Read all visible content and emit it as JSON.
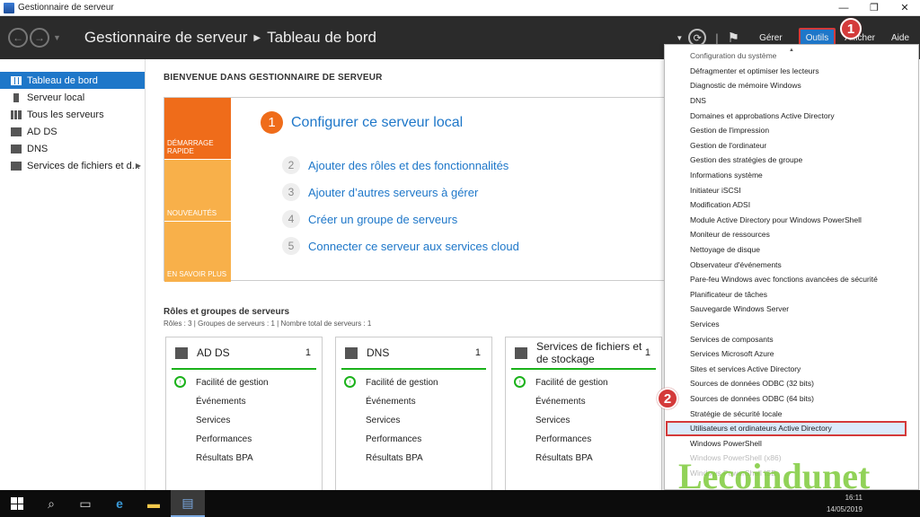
{
  "window": {
    "title": "Gestionnaire de serveur",
    "minimize": "—",
    "restore": "❐",
    "close": "✕"
  },
  "header": {
    "breadcrumb_app": "Gestionnaire de serveur",
    "breadcrumb_page": "Tableau de bord",
    "menus": {
      "gerer": "Gérer",
      "outils": "Outils",
      "afficher": "Afficher",
      "aide": "Aide"
    }
  },
  "sidebar": {
    "items": [
      {
        "label": "Tableau de bord"
      },
      {
        "label": "Serveur local"
      },
      {
        "label": "Tous les serveurs"
      },
      {
        "label": "AD DS"
      },
      {
        "label": "DNS"
      },
      {
        "label": "Services de fichiers et d..."
      }
    ]
  },
  "welcome": {
    "title": "BIENVENUE DANS GESTIONNAIRE DE SERVEUR",
    "tiles": [
      "DÉMARRAGE RAPIDE",
      "NOUVEAUTÉS",
      "EN SAVOIR PLUS"
    ],
    "steps": [
      {
        "num": "1",
        "label": "Configurer ce serveur local"
      },
      {
        "num": "2",
        "label": "Ajouter des rôles et des fonctionnalités"
      },
      {
        "num": "3",
        "label": "Ajouter d’autres serveurs à gérer"
      },
      {
        "num": "4",
        "label": "Créer un groupe de serveurs"
      },
      {
        "num": "5",
        "label": "Connecter ce serveur aux services cloud"
      }
    ]
  },
  "roles": {
    "title": "Rôles et groupes de serveurs",
    "summary": "Rôles : 3   |   Groupes de serveurs : 1   |   Nombre total de serveurs : 1",
    "cards": [
      {
        "name": "AD DS",
        "count": "1",
        "rows": [
          "Facilité de gestion",
          "Événements",
          "Services",
          "Performances",
          "Résultats BPA"
        ]
      },
      {
        "name": "DNS",
        "count": "1",
        "rows": [
          "Facilité de gestion",
          "Événements",
          "Services",
          "Performances",
          "Résultats BPA"
        ]
      },
      {
        "name": "Services de fichiers et de stockage",
        "count": "1",
        "rows": [
          "Facilité de gestion",
          "Événements",
          "Services",
          "Performances",
          "Résultats BPA"
        ]
      }
    ]
  },
  "tools_menu": {
    "items": [
      "Configuration du système",
      "Défragmenter et optimiser les lecteurs",
      "Diagnostic de mémoire Windows",
      "DNS",
      "Domaines et approbations Active Directory",
      "Gestion de l'impression",
      "Gestion de l'ordinateur",
      "Gestion des stratégies de groupe",
      "Informations système",
      "Initiateur iSCSI",
      "Modification ADSI",
      "Module Active Directory pour Windows PowerShell",
      "Moniteur de ressources",
      "Nettoyage de disque",
      "Observateur d'événements",
      "Pare-feu Windows avec fonctions avancées de sécurité",
      "Planificateur de tâches",
      "Sauvegarde Windows Server",
      "Services",
      "Services de composants",
      "Services Microsoft Azure",
      "Sites et services Active Directory",
      "Sources de données ODBC (32 bits)",
      "Sources de données ODBC (64 bits)",
      "Stratégie de sécurité locale",
      "Utilisateurs et ordinateurs Active Directory",
      "Windows PowerShell",
      "Windows PowerShell (x86)",
      "Windows PowerShell ISE"
    ]
  },
  "badges": [
    "1",
    "2"
  ],
  "watermark": "Lecoindunet",
  "taskbar": {
    "time": "16:11",
    "date": "14/05/2019"
  },
  "colors": {
    "accent": "#1e77c9",
    "orange": "#ef6c1a",
    "tile_yellow": "#f8b04a",
    "ok_green": "#1bb21b",
    "badge_red": "#d43a3a"
  }
}
